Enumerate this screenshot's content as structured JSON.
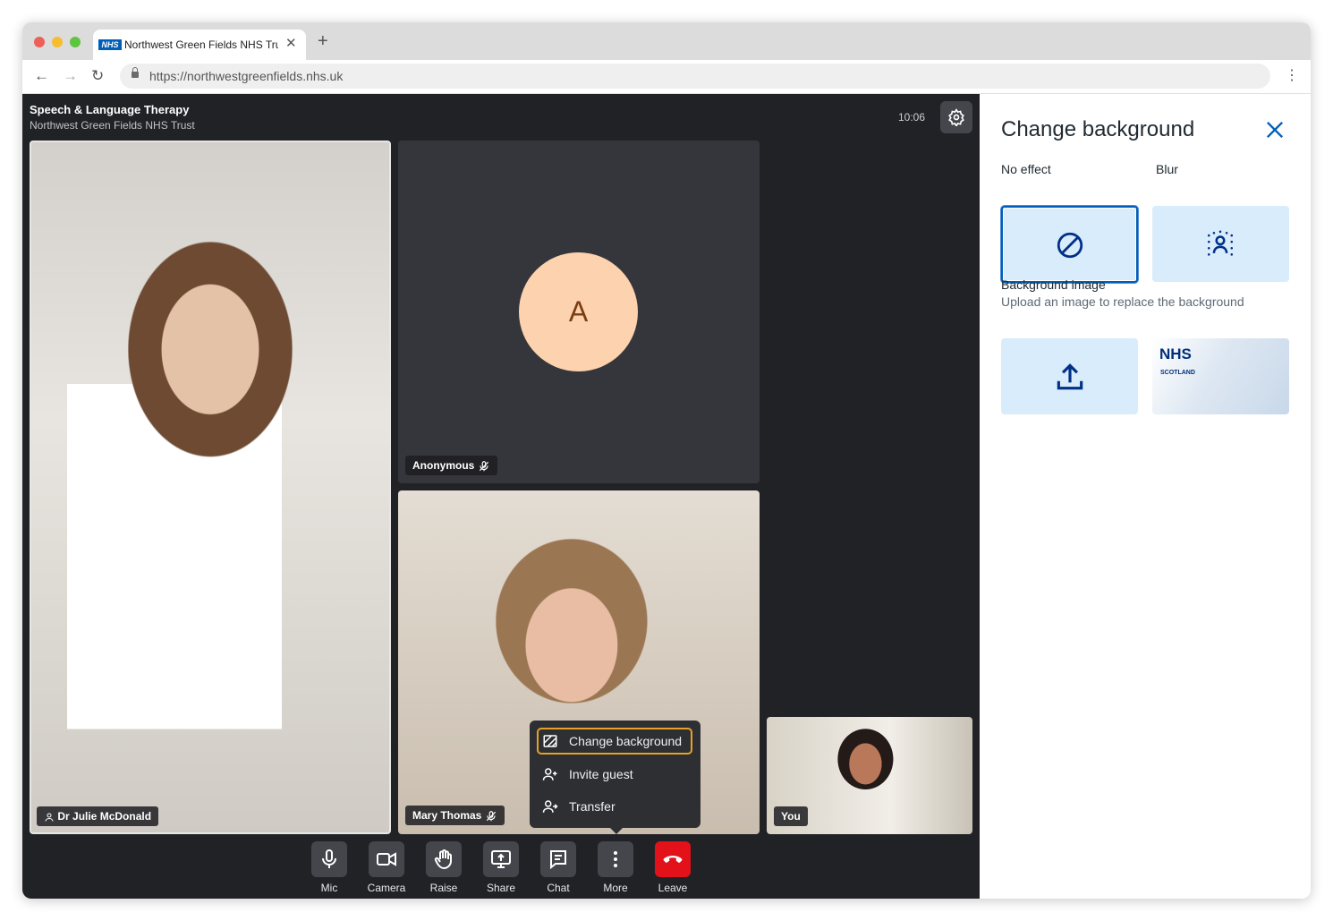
{
  "browser": {
    "tab": {
      "logo": "NHS",
      "title": "Northwest Green Fields NHS Trust"
    },
    "url": "https://northwestgreenfields.nhs.uk"
  },
  "call": {
    "title": "Speech & Language Therapy",
    "subtitle": "Northwest Green Fields NHS Trust",
    "time": "10:06"
  },
  "participants": [
    {
      "name": "Dr Julie McDonald",
      "has_host_icon": true
    },
    {
      "name": "Anonymous",
      "initial": "A",
      "muted": true
    },
    {
      "name": "Mary Thomas",
      "muted": true
    },
    {
      "name": "You"
    }
  ],
  "more_menu": {
    "items": [
      {
        "label": "Change background",
        "icon": "background-icon",
        "active": true
      },
      {
        "label": "Invite guest",
        "icon": "person-add-icon"
      },
      {
        "label": "Transfer",
        "icon": "person-transfer-icon"
      }
    ]
  },
  "controls": [
    {
      "label": "Mic",
      "icon": "mic-icon"
    },
    {
      "label": "Camera",
      "icon": "camera-icon"
    },
    {
      "label": "Raise",
      "icon": "hand-icon"
    },
    {
      "label": "Share",
      "icon": "share-screen-icon"
    },
    {
      "label": "Chat",
      "icon": "chat-icon"
    },
    {
      "label": "More",
      "icon": "more-icon"
    },
    {
      "label": "Leave",
      "icon": "phone-hangup-icon"
    }
  ],
  "panel": {
    "title": "Change background",
    "options": {
      "none_label": "No effect",
      "blur_label": "Blur"
    },
    "bg_image": {
      "title": "Background image",
      "subtitle": "Upload an image to replace the background",
      "nhs_text": "NHS",
      "nhs_sub": "SCOTLAND"
    }
  },
  "colors": {
    "accent": "#005eb8",
    "menu_focus": "#e5a228",
    "leave": "#e2111a",
    "avatar_bg": "#fdd2ae"
  }
}
